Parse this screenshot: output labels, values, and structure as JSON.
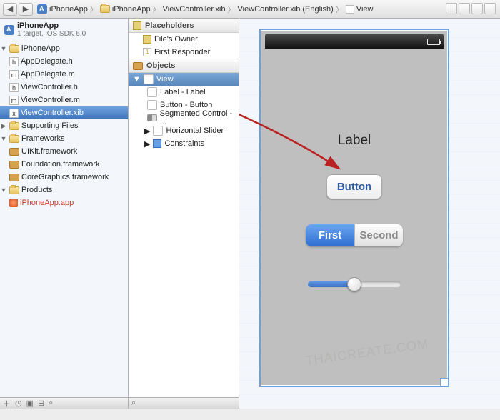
{
  "breadcrumb": {
    "items": [
      "iPhoneApp",
      "iPhoneApp",
      "ViewController.xib",
      "ViewController.xib (English)",
      "View"
    ]
  },
  "project": {
    "name": "iPhoneApp",
    "subtitle": "1 target, iOS SDK 6.0",
    "tree": [
      {
        "label": "iPhoneApp",
        "type": "folder",
        "depth": 1,
        "open": true
      },
      {
        "label": "AppDelegate.h",
        "type": "h",
        "depth": 2
      },
      {
        "label": "AppDelegate.m",
        "type": "m",
        "depth": 2
      },
      {
        "label": "ViewController.h",
        "type": "h",
        "depth": 2
      },
      {
        "label": "ViewController.m",
        "type": "m",
        "depth": 2
      },
      {
        "label": "ViewController.xib",
        "type": "xib",
        "depth": 2,
        "selected": true
      },
      {
        "label": "Supporting Files",
        "type": "folder",
        "depth": 2,
        "closed": true
      },
      {
        "label": "Frameworks",
        "type": "folder",
        "depth": 1,
        "open": true
      },
      {
        "label": "UIKit.framework",
        "type": "fw",
        "depth": 2
      },
      {
        "label": "Foundation.framework",
        "type": "fw",
        "depth": 2
      },
      {
        "label": "CoreGraphics.framework",
        "type": "fw",
        "depth": 2
      },
      {
        "label": "Products",
        "type": "folder",
        "depth": 1,
        "open": true
      },
      {
        "label": "iPhoneApp.app",
        "type": "app",
        "depth": 2,
        "red": true
      }
    ]
  },
  "outline": {
    "placeholders_title": "Placeholders",
    "placeholders": [
      {
        "label": "File's Owner",
        "icon": "cube"
      },
      {
        "label": "First Responder",
        "icon": "red"
      }
    ],
    "objects_title": "Objects",
    "objects": [
      {
        "label": "View",
        "selected": true,
        "open": true,
        "depth": 0
      },
      {
        "label": "Label - Label",
        "depth": 1,
        "box": true
      },
      {
        "label": "Button - Button",
        "depth": 1,
        "box": true
      },
      {
        "label": "Segmented Control - ...",
        "depth": 1,
        "icon": "seg"
      },
      {
        "label": "Horizontal Slider",
        "depth": 1,
        "box": true,
        "closed": true
      },
      {
        "label": "Constraints",
        "depth": 1,
        "icon": "blue",
        "closed": true
      }
    ]
  },
  "canvas": {
    "label_text": "Label",
    "button_text": "Button",
    "segment_first": "First",
    "segment_second": "Second",
    "watermark": "THAICREATE.COM"
  }
}
